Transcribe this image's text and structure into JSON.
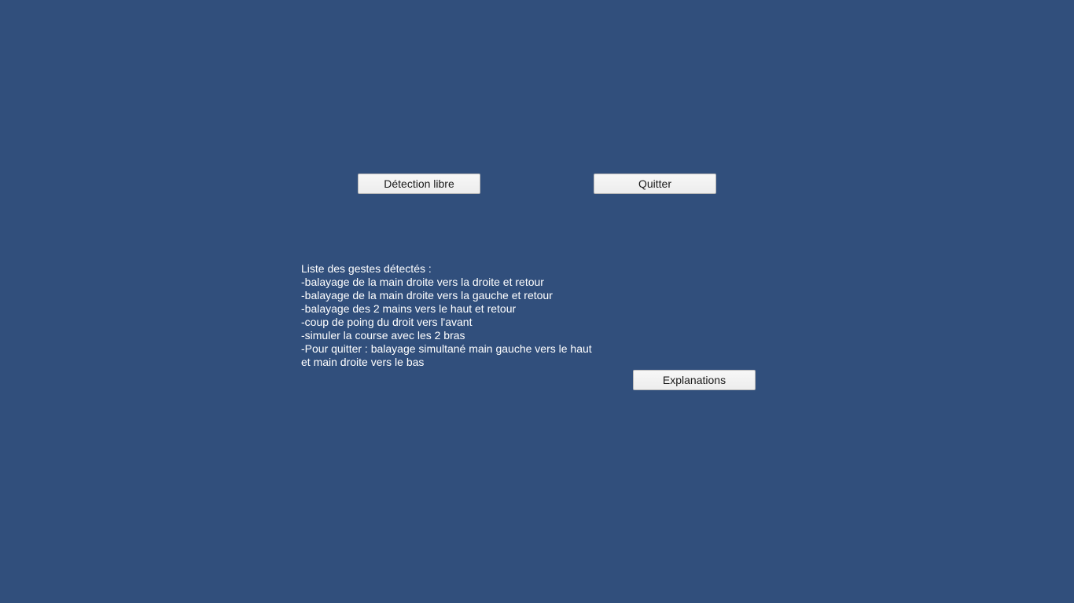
{
  "menu": {
    "detection_label": "Détection libre",
    "quit_label": "Quitter",
    "explanations_label": "Explanations"
  },
  "gestures": {
    "title": "Liste des gestes détectés :",
    "items": [
      "-balayage de la main droite vers la droite et retour",
      "-balayage de la main droite vers la gauche et retour",
      "-balayage des 2 mains vers le haut et retour",
      "-coup de poing du droit vers l'avant",
      "-simuler la course avec les 2 bras",
      "-Pour quitter : balayage simultané main gauche vers le haut",
      "et main droite vers le bas"
    ]
  },
  "colors": {
    "background": "#314f7c",
    "button_bg": "#f0f0f0",
    "text": "#ffffff"
  }
}
